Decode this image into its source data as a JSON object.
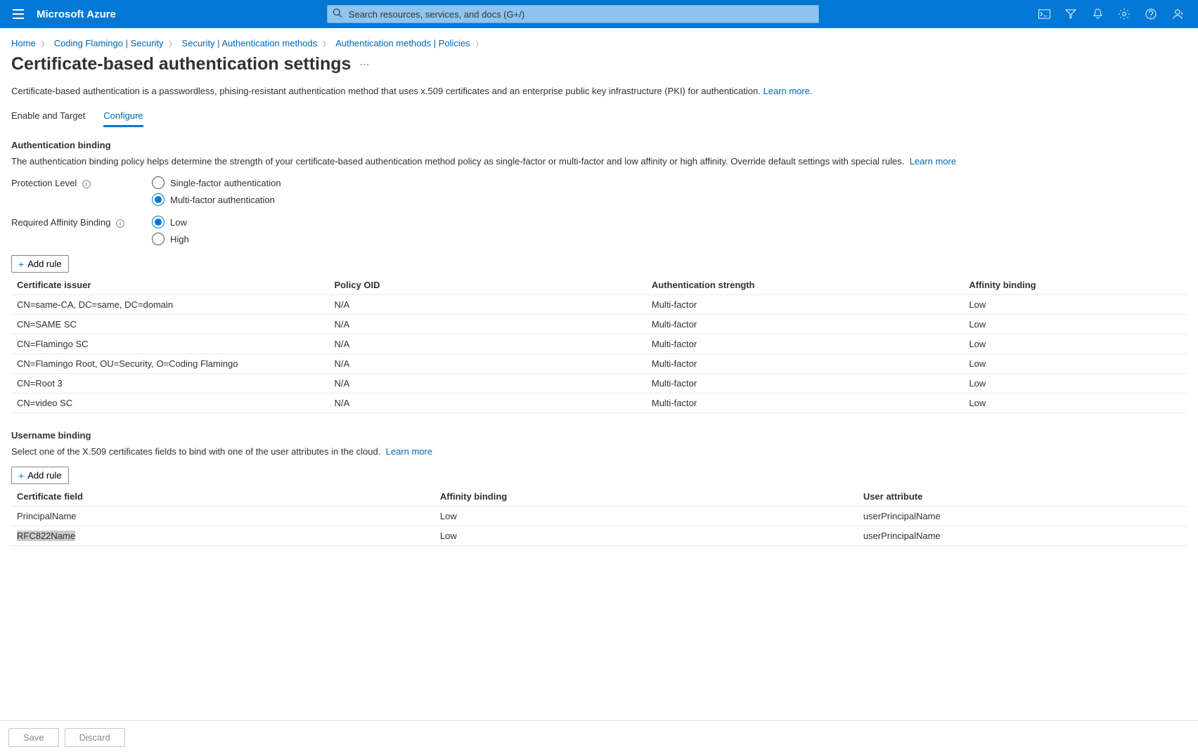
{
  "header": {
    "brand": "Microsoft Azure",
    "search_placeholder": "Search resources, services, and docs (G+/)"
  },
  "breadcrumbs": [
    "Home",
    "Coding Flamingo | Security",
    "Security | Authentication methods",
    "Authentication methods | Policies"
  ],
  "page_title": "Certificate-based authentication settings",
  "intro_text": "Certificate-based authentication is a passwordless, phising-resistant authentication method that uses x.509 certificates and an enterprise public key infrastructure (PKI) for authentication.",
  "learn_more": "Learn more",
  "tabs": {
    "enable": "Enable and Target",
    "configure": "Configure"
  },
  "auth_binding": {
    "heading": "Authentication binding",
    "desc": "The authentication binding policy helps determine the strength of your certificate-based authentication method policy as single-factor or multi-factor and low affinity or high affinity. Override default settings with special rules.",
    "protection_label": "Protection Level",
    "protection_options": {
      "single": "Single-factor authentication",
      "multi": "Multi-factor authentication"
    },
    "affinity_label": "Required Affinity Binding",
    "affinity_options": {
      "low": "Low",
      "high": "High"
    },
    "add_rule": "Add rule",
    "table": {
      "headers": [
        "Certificate issuer",
        "Policy OID",
        "Authentication strength",
        "Affinity binding"
      ],
      "rows": [
        {
          "issuer": "CN=same-CA, DC=same, DC=domain",
          "oid": "N/A",
          "strength": "Multi-factor",
          "aff": "Low"
        },
        {
          "issuer": "CN=SAME SC",
          "oid": "N/A",
          "strength": "Multi-factor",
          "aff": "Low"
        },
        {
          "issuer": "CN=Flamingo SC",
          "oid": "N/A",
          "strength": "Multi-factor",
          "aff": "Low"
        },
        {
          "issuer": "CN=Flamingo Root, OU=Security, O=Coding Flamingo",
          "oid": "N/A",
          "strength": "Multi-factor",
          "aff": "Low"
        },
        {
          "issuer": "CN=Root 3",
          "oid": "N/A",
          "strength": "Multi-factor",
          "aff": "Low"
        },
        {
          "issuer": "CN=video SC",
          "oid": "N/A",
          "strength": "Multi-factor",
          "aff": "Low"
        }
      ]
    }
  },
  "user_binding": {
    "heading": "Username binding",
    "desc": "Select one of the X.509 certificates fields to bind with one of the user attributes in the cloud.",
    "add_rule": "Add rule",
    "table": {
      "headers": [
        "Certificate field",
        "Affinity binding",
        "User attribute"
      ],
      "rows": [
        {
          "field": "PrincipalName",
          "aff": "Low",
          "attr": "userPrincipalName"
        },
        {
          "field": "RFC822Name",
          "aff": "Low",
          "attr": "userPrincipalName"
        }
      ]
    }
  },
  "footer": {
    "save": "Save",
    "discard": "Discard"
  }
}
